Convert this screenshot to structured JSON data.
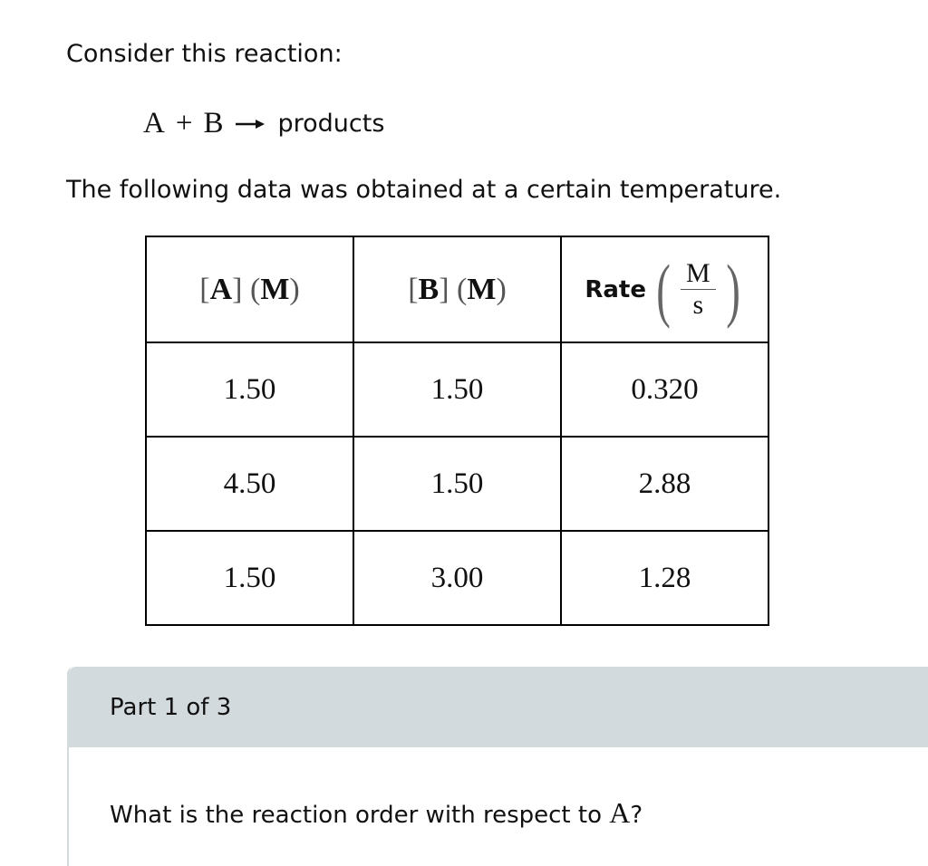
{
  "intro": "Consider this reaction:",
  "equation": {
    "reactant_a": "A",
    "plus": "+",
    "reactant_b": "B",
    "arrow_icon": "right-arrow",
    "products": "products"
  },
  "following": "The following data was obtained at a certain temperature.",
  "table": {
    "headers": {
      "a": {
        "open": "[",
        "symbol": "A",
        "close": "]",
        "unit": "(M)"
      },
      "b": {
        "open": "[",
        "symbol": "B",
        "close": "]",
        "unit": "(M)"
      },
      "rate": {
        "label": "Rate",
        "lparen": "(",
        "num": "M",
        "den": "s",
        "rparen": ")"
      }
    },
    "rows": [
      [
        "1.50",
        "1.50",
        "0.320"
      ],
      [
        "4.50",
        "1.50",
        "2.88"
      ],
      [
        "1.50",
        "3.00",
        "1.28"
      ]
    ]
  },
  "part": {
    "header": "Part 1 of 3",
    "question_prefix": "What is the reaction order with respect to ",
    "question_var": "A",
    "question_suffix": "?",
    "header_color": "#d3dadd"
  }
}
